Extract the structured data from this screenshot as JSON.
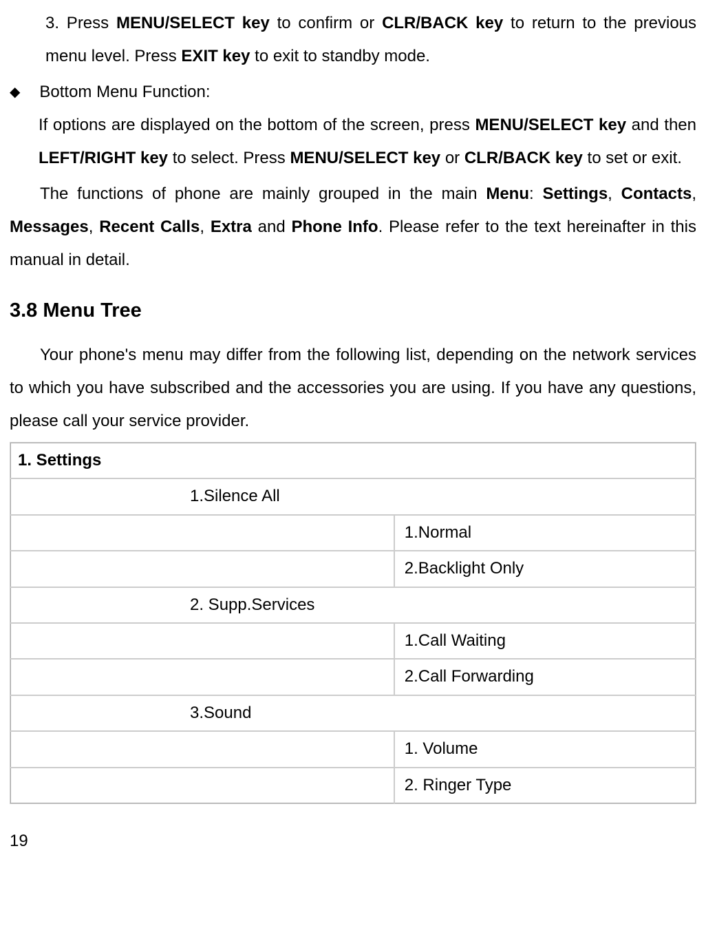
{
  "list3": {
    "prefix": "3. Press ",
    "b1": "MENU/SELECT key",
    "mid1": " to confirm or ",
    "b2": "CLR/BACK key",
    "mid2": " to return to the previous menu level. Press ",
    "b3": "EXIT key",
    "suffix": " to exit to standby mode."
  },
  "bullet": {
    "title": "Bottom Menu Function:",
    "p_prefix": "If options are displayed on the bottom of the screen, press ",
    "b1": "MENU/SELECT key",
    "p_mid1": " and then ",
    "b2": "LEFT/RIGHT key",
    "p_mid2": " to select. Press ",
    "b3": "MENU/SELECT key",
    "p_mid3": " or ",
    "b4": "CLR/BACK key",
    "p_suffix": " to set or exit."
  },
  "para1": {
    "prefix": "The functions of phone are mainly grouped in the main ",
    "b1": "Menu",
    "sep1": ": ",
    "b2": "Settings",
    "sep2": ", ",
    "b3": "Contacts",
    "sep3": ", ",
    "b4": "Messages",
    "sep4": ", ",
    "b5": "Recent Calls",
    "sep5": ", ",
    "b6": "Extra",
    "sep6": " and ",
    "b7": "Phone Info",
    "suffix": ". Please refer to the text hereinafter in this manual in detail."
  },
  "heading": "3.8 Menu Tree",
  "para2": "Your phone's menu may differ from the following list, depending on the network services to which you have subscribed and the accessories you are using. If you have any questions, please call your service provider.",
  "table": {
    "header": "1. Settings",
    "row1": "1.Silence All",
    "row1a": "1.Normal",
    "row1b": "2.Backlight Only",
    "row2": "2. Supp.Services",
    "row2a": "1.Call Waiting",
    "row2b": "2.Call Forwarding",
    "row3": "3.Sound",
    "row3a": "1. Volume",
    "row3b": "2. Ringer Type"
  },
  "page_number": "19"
}
